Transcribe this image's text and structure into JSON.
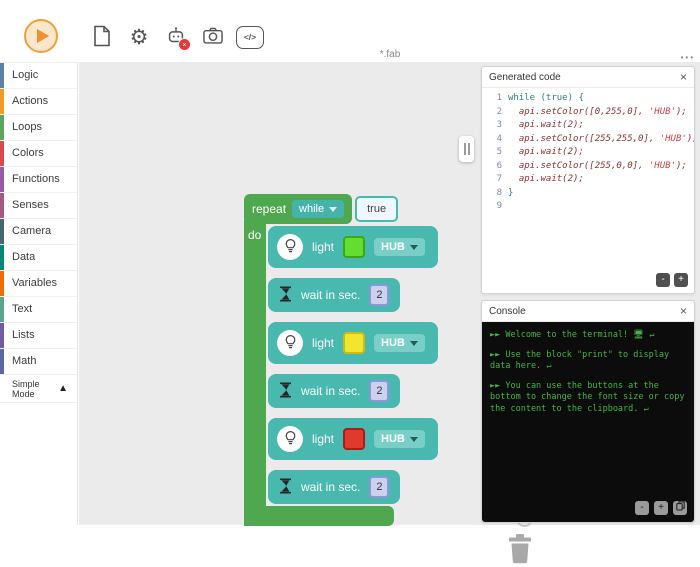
{
  "header": {
    "filename": "*.fab"
  },
  "toolbar": {
    "icons": [
      "play-icon",
      "file-icon",
      "gear-icon",
      "robot-disconnected-icon",
      "camera-icon",
      "code-icon"
    ],
    "gear_glyph": "⚙",
    "code_glyph": "</>",
    "robot_badge": "×"
  },
  "sidebar": {
    "categories": [
      {
        "label": "Logic",
        "color": "#5C81A6"
      },
      {
        "label": "Actions",
        "color": "#F29B27"
      },
      {
        "label": "Loops",
        "color": "#5CA65C"
      },
      {
        "label": "Colors",
        "color": "#D64B4B"
      },
      {
        "label": "Functions",
        "color": "#995BA5"
      },
      {
        "label": "Senses",
        "color": "#A55B80"
      },
      {
        "label": "Camera",
        "color": "#4A6572"
      },
      {
        "label": "Data",
        "color": "#00897B"
      },
      {
        "label": "Variables",
        "color": "#EF6C00"
      },
      {
        "label": "Text",
        "color": "#5CA68D"
      },
      {
        "label": "Lists",
        "color": "#745BA5"
      },
      {
        "label": "Math",
        "color": "#5C68A6"
      }
    ],
    "simple_mode": {
      "label": "Simple Mode",
      "arrow": "▲"
    }
  },
  "workspace": {
    "repeat_block": {
      "label": "repeat",
      "mode": "while",
      "condition": "true",
      "do_label": "do",
      "colors": {
        "loop_green": "#4FA84F",
        "block_teal": "#49B8AF"
      },
      "body": [
        {
          "type": "light",
          "label": "light",
          "color": "#63DD30",
          "border": "#3FA512",
          "target": "HUB"
        },
        {
          "type": "wait",
          "label": "wait in sec.",
          "value": "2"
        },
        {
          "type": "light",
          "label": "light",
          "color": "#F2E52E",
          "border": "#C9BC12",
          "target": "HUB"
        },
        {
          "type": "wait",
          "label": "wait in sec.",
          "value": "2"
        },
        {
          "type": "light",
          "label": "light",
          "color": "#E0392D",
          "border": "#A81E14",
          "target": "HUB"
        },
        {
          "type": "wait",
          "label": "wait in sec.",
          "value": "2"
        }
      ]
    }
  },
  "generated_code_panel": {
    "title": "Generated code",
    "close": "×",
    "lines": [
      "while (true) {",
      "  api.setColor([0,255,0], 'HUB');",
      "  api.wait(2);",
      "  api.setColor([255,255,0], 'HUB');",
      "  api.wait(2);",
      "  api.setColor([255,0,0], 'HUB');",
      "  api.wait(2);",
      "}",
      ""
    ],
    "buttons": {
      "decrease": "-",
      "increase": "+"
    }
  },
  "console_panel": {
    "title": "Console",
    "close": "×",
    "lines": [
      "►► Welcome to the terminal! 🖥 ↵",
      "►► Use the block \"print\" to display data here. ↵",
      "►► You can use the buttons at the bottom to change the font size or copy the content to the clipboard. ↵"
    ],
    "buttons": {
      "decrease": "-",
      "increase": "+",
      "copy": "copy-icon"
    }
  },
  "overflow_menu": "•••"
}
